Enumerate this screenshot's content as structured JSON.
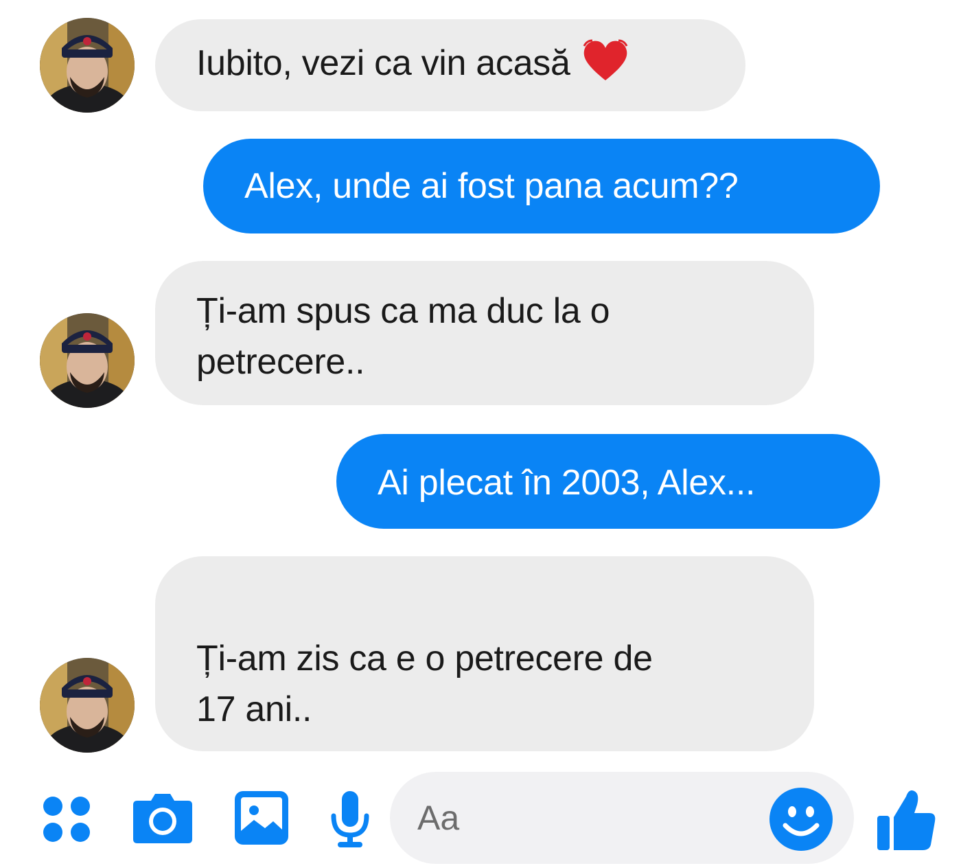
{
  "messages": [
    {
      "side": "in",
      "text": "Iubito, vezi ca vin acasă",
      "emoji": "heart"
    },
    {
      "side": "out",
      "text": "Alex, unde ai fost pana acum??"
    },
    {
      "side": "in",
      "line1": "Ți-am spus ca ma duc la o",
      "line2": "petrecere.."
    },
    {
      "side": "out",
      "text": "Ai plecat în 2003, Alex..."
    },
    {
      "side": "in",
      "line1": "Ți-am zis ca e o petrecere de",
      "line2": "17 ani.."
    }
  ],
  "composer": {
    "placeholder": "Aa",
    "icons": [
      "apps-icon",
      "camera-icon",
      "image-icon",
      "microphone-icon",
      "emoji-icon",
      "thumbs-up-icon"
    ]
  },
  "colors": {
    "accent": "#0a84f5",
    "incoming_bubble": "#ececec",
    "heart": "#e0242c"
  }
}
